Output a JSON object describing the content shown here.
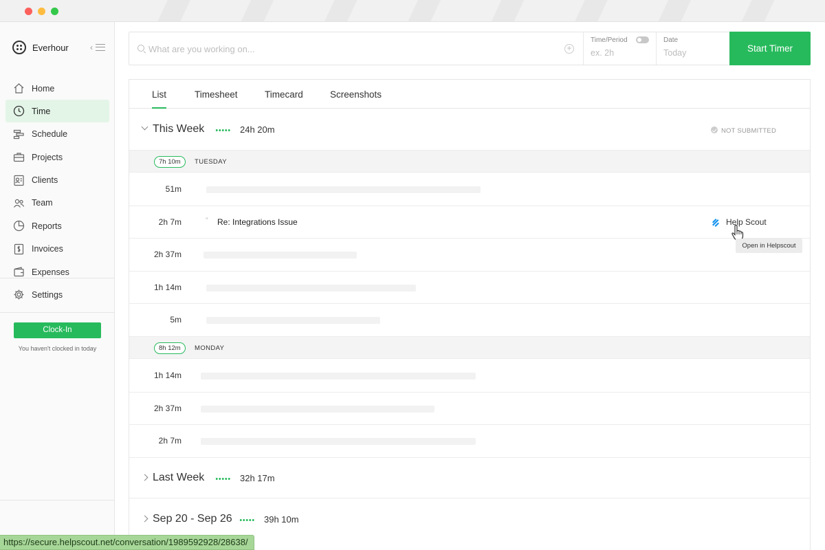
{
  "app": {
    "name": "Everhour"
  },
  "sidebar": {
    "items": [
      {
        "label": "Home",
        "icon": "home-icon",
        "active": false
      },
      {
        "label": "Time",
        "icon": "clock-icon",
        "active": true
      },
      {
        "label": "Schedule",
        "icon": "schedule-icon",
        "active": false
      },
      {
        "label": "Projects",
        "icon": "briefcase-icon",
        "active": false
      },
      {
        "label": "Clients",
        "icon": "contact-card-icon",
        "active": false
      },
      {
        "label": "Team",
        "icon": "people-icon",
        "active": false
      },
      {
        "label": "Reports",
        "icon": "pie-chart-icon",
        "active": false
      },
      {
        "label": "Invoices",
        "icon": "invoice-icon",
        "active": false
      },
      {
        "label": "Expenses",
        "icon": "wallet-icon",
        "active": false
      }
    ],
    "settings_label": "Settings",
    "clockin_label": "Clock-In",
    "clockin_note": "You haven't clocked in today"
  },
  "timer": {
    "placeholder": "What are you working on...",
    "time_period_label": "Time/Period",
    "time_period_placeholder": "ex. 2h",
    "date_label": "Date",
    "date_placeholder": "Today",
    "start_label": "Start Timer"
  },
  "tabs": [
    {
      "label": "List",
      "active": true
    },
    {
      "label": "Timesheet",
      "active": false
    },
    {
      "label": "Timecard",
      "active": false
    },
    {
      "label": "Screenshots",
      "active": false
    }
  ],
  "this_week": {
    "title": "This Week",
    "total": "24h 20m",
    "status": "NOT SUBMITTED",
    "days": [
      {
        "total": "7h 10m",
        "name": "TUESDAY",
        "entries": [
          {
            "duration": "51m"
          },
          {
            "duration": "2h 7m",
            "task": "Re: Integrations Issue",
            "integration": "Help Scout"
          },
          {
            "duration": "2h 37m"
          },
          {
            "duration": "1h 14m"
          },
          {
            "duration": "5m"
          }
        ]
      },
      {
        "total": "8h 12m",
        "name": "MONDAY",
        "entries": [
          {
            "duration": "1h 14m"
          },
          {
            "duration": "2h 37m"
          },
          {
            "duration": "2h 7m"
          }
        ]
      }
    ]
  },
  "last_week": {
    "title": "Last Week",
    "total": "32h 17m"
  },
  "sep_week": {
    "title": "Sep 20 - Sep 26",
    "total": "39h 10m"
  },
  "tooltip": "Open in Helpscout",
  "status_url": "https://secure.helpscout.net/conversation/1989592928/28638/",
  "colors": {
    "accent": "#27ba5c",
    "helpscout": "#1292ee"
  }
}
